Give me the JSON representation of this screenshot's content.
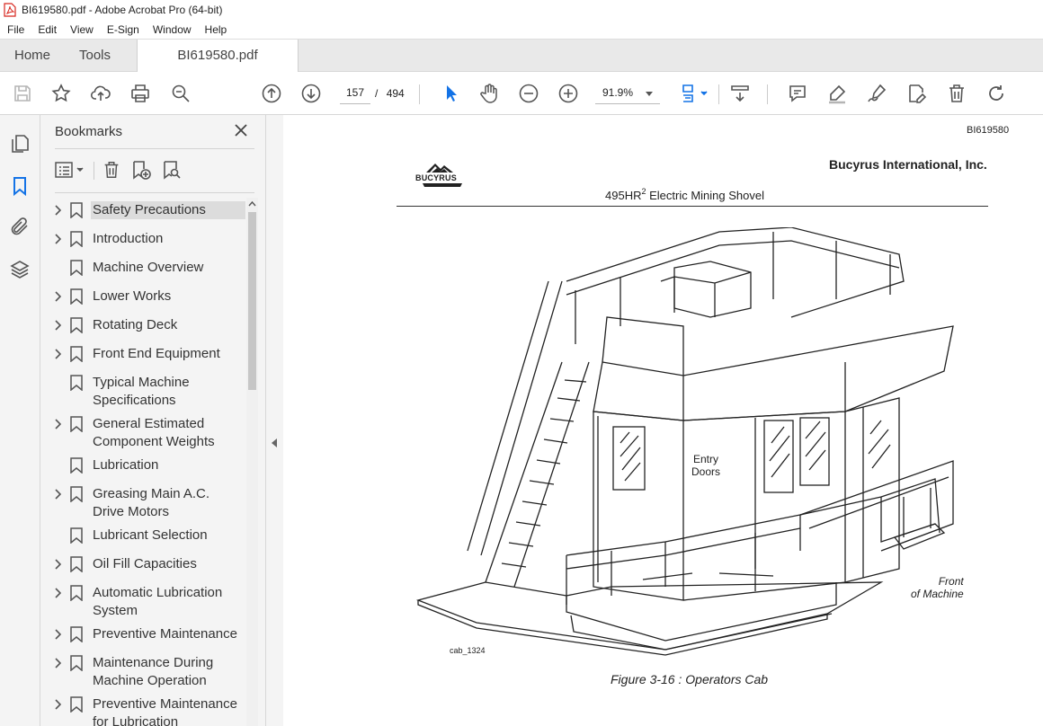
{
  "window": {
    "title": "BI619580.pdf - Adobe Acrobat Pro (64-bit)"
  },
  "menu": [
    "File",
    "Edit",
    "View",
    "E-Sign",
    "Window",
    "Help"
  ],
  "tabs": {
    "home": "Home",
    "tools": "Tools",
    "document": "BI619580.pdf"
  },
  "toolbar": {
    "current_page": "157",
    "page_separator": "/",
    "total_pages": "494",
    "zoom": "91.9%"
  },
  "panel": {
    "title": "Bookmarks",
    "bookmarks": [
      {
        "label": "Safety Precautions",
        "expandable": true,
        "selected": true
      },
      {
        "label": "Introduction",
        "expandable": true
      },
      {
        "label": "Machine Overview",
        "expandable": false
      },
      {
        "label": "Lower Works",
        "expandable": true
      },
      {
        "label": "Rotating Deck",
        "expandable": true
      },
      {
        "label": "Front End Equipment",
        "expandable": true
      },
      {
        "label": "Typical Machine Specifications",
        "expandable": false
      },
      {
        "label": "General Estimated Component Weights",
        "expandable": true
      },
      {
        "label": "Lubrication",
        "expandable": false
      },
      {
        "label": "Greasing Main A.C. Drive Motors",
        "expandable": true
      },
      {
        "label": "Lubricant Selection",
        "expandable": false
      },
      {
        "label": "Oil Fill Capacities",
        "expandable": true
      },
      {
        "label": "Automatic Lubrication System",
        "expandable": true
      },
      {
        "label": "Preventive Maintenance",
        "expandable": true
      },
      {
        "label": "Maintenance During Machine Operation",
        "expandable": true
      },
      {
        "label": "Preventive Maintenance for Lubrication",
        "expandable": true
      }
    ]
  },
  "document": {
    "doc_id": "BI619580",
    "company": "Bucyrus International, Inc.",
    "logo_text": "BUCYRUS",
    "subtitle_main": "495HR",
    "subtitle_sup": "2",
    "subtitle_rest": " Electric Mining Shovel",
    "figure_label_entry": "Entry Doors",
    "figure_label_front_1": "Front",
    "figure_label_front_2": "of Machine",
    "image_id": "cab_1324",
    "caption": "Figure 3-16 : Operators Cab"
  },
  "colors": {
    "accent_blue": "#1473e6",
    "panel_bg": "#f4f4f4",
    "tab_bar": "#e9e9e9",
    "pdf_red": "#d7261e"
  }
}
